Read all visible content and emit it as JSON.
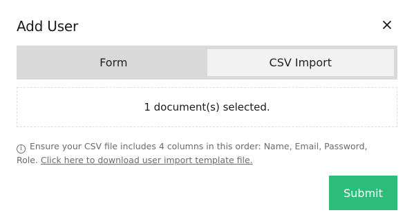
{
  "dialog": {
    "title": "Add User",
    "close_label": "×"
  },
  "tabs": [
    {
      "label": "Form",
      "active": false
    },
    {
      "label": "CSV Import",
      "active": true
    }
  ],
  "dropzone": {
    "text": "1 document(s) selected."
  },
  "note": {
    "info_glyph": "i",
    "text": "Ensure your CSV file includes 4 columns in this order: Name, Email, Password, Role.",
    "link_text": "Click here to download user import template file."
  },
  "submit": {
    "label": "Submit"
  },
  "colors": {
    "accent": "#2ebd78",
    "tab_bar": "#d9d9d9",
    "tab_active": "#f2f2f2"
  }
}
